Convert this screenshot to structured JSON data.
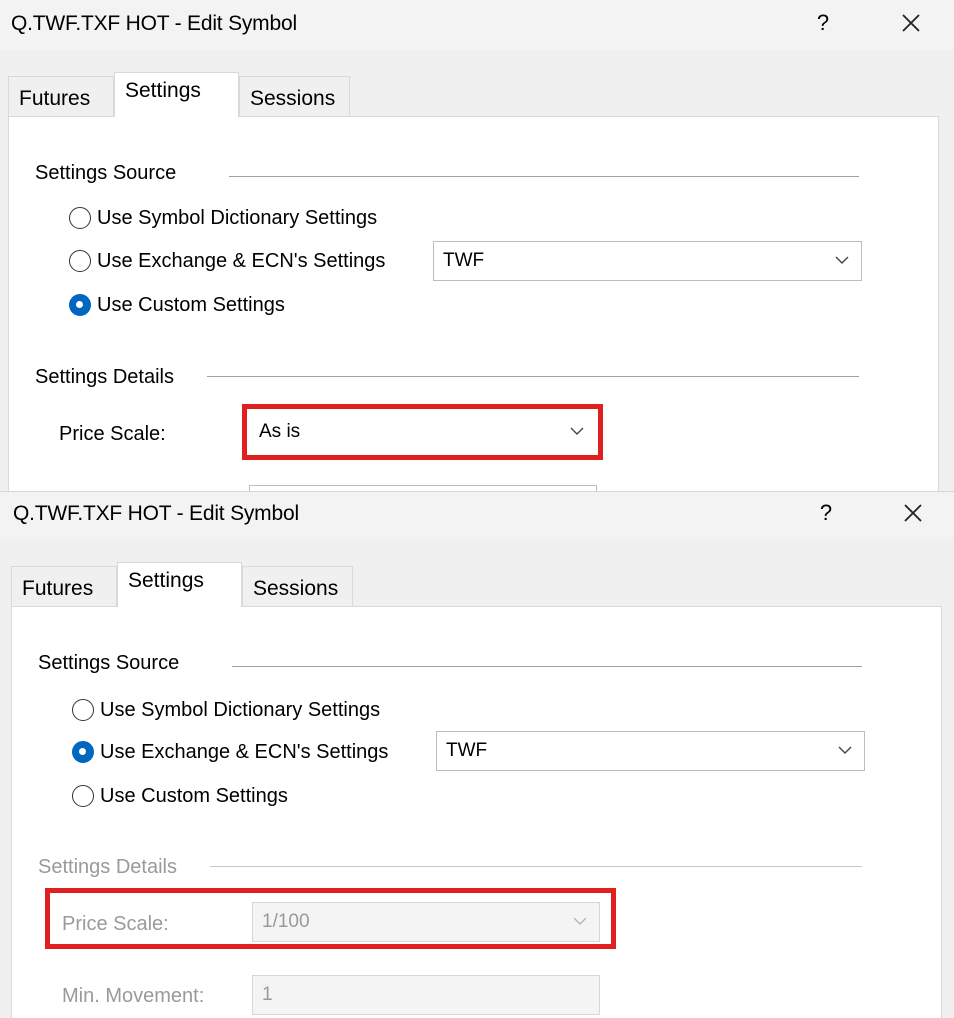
{
  "dialog1": {
    "title": "Q.TWF.TXF HOT - Edit Symbol",
    "help_label": "?",
    "tabs": [
      {
        "label": "Futures",
        "active": false
      },
      {
        "label": "Settings",
        "active": true
      },
      {
        "label": "Sessions",
        "active": false
      }
    ],
    "settings_source": {
      "heading": "Settings Source",
      "options": [
        {
          "label": "Use Symbol Dictionary Settings",
          "checked": false
        },
        {
          "label": "Use Exchange & ECN's Settings",
          "checked": false
        },
        {
          "label": "Use Custom Settings",
          "checked": true
        }
      ],
      "exchange_select_value": "TWF"
    },
    "settings_details": {
      "heading": "Settings Details",
      "price_scale_label": "Price Scale:",
      "price_scale_value": "As is",
      "enabled": true
    }
  },
  "dialog2": {
    "title": "Q.TWF.TXF HOT - Edit Symbol",
    "help_label": "?",
    "tabs": [
      {
        "label": "Futures",
        "active": false
      },
      {
        "label": "Settings",
        "active": true
      },
      {
        "label": "Sessions",
        "active": false
      }
    ],
    "settings_source": {
      "heading": "Settings Source",
      "options": [
        {
          "label": "Use Symbol Dictionary Settings",
          "checked": false
        },
        {
          "label": "Use Exchange & ECN's Settings",
          "checked": true
        },
        {
          "label": "Use Custom Settings",
          "checked": false
        }
      ],
      "exchange_select_value": "TWF"
    },
    "settings_details": {
      "heading": "Settings Details",
      "price_scale_label": "Price Scale:",
      "price_scale_value": "1/100",
      "min_movement_label": "Min. Movement:",
      "min_movement_value": "1",
      "enabled": false
    }
  },
  "colors": {
    "highlight": "#e02020",
    "radio_checked": "#0067c0",
    "disabled_text": "#9a9a9a"
  },
  "icons": {
    "close": "close-icon",
    "help": "help-icon",
    "dropdown": "chevron-down-icon"
  }
}
